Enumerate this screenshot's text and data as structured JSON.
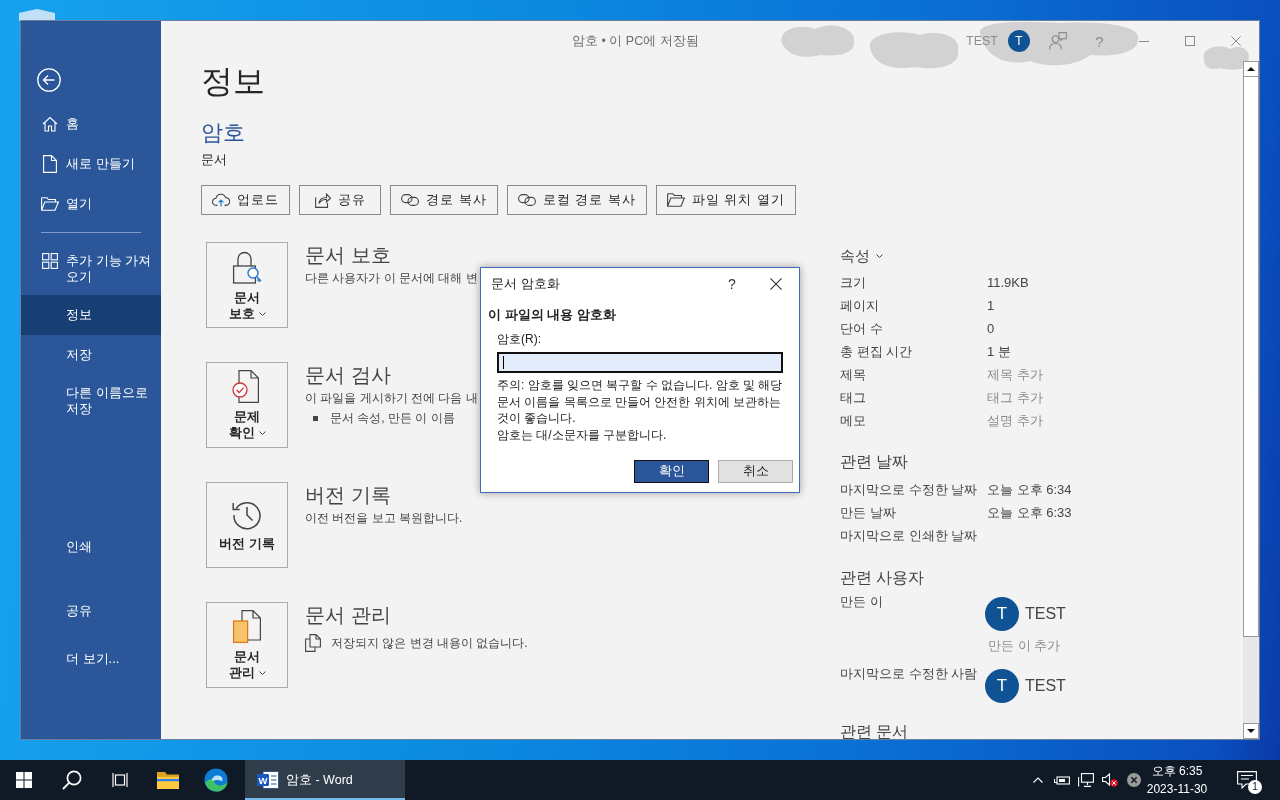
{
  "window": {
    "title": "암호 • 이 PC에 저장됨",
    "account": {
      "name": "TEST",
      "initial": "T"
    },
    "help": "?"
  },
  "sidebar": {
    "top_items": [
      {
        "lines": [
          "홈"
        ],
        "selected": false
      },
      {
        "lines": [
          "새로 만들기"
        ],
        "selected": false
      },
      {
        "lines": [
          "열기"
        ],
        "selected": false
      }
    ],
    "middle_items": [
      {
        "lines": [
          "추가 기능 가져",
          "오기"
        ],
        "selected": false
      },
      {
        "lines": [
          "정보"
        ],
        "selected": true
      },
      {
        "lines": [
          "저장"
        ],
        "selected": false
      },
      {
        "lines": [
          "다른 이름으로",
          "저장"
        ],
        "selected": false
      }
    ],
    "bottom_items": [
      {
        "lines": [
          "인쇄"
        ],
        "selected": false
      },
      {
        "lines": [
          "공유"
        ],
        "selected": false
      },
      {
        "lines": [
          "더 보기..."
        ],
        "selected": false
      }
    ]
  },
  "info": {
    "heading": "정보",
    "document_name": "암호",
    "document_location": "문서",
    "actions": [
      {
        "label": "업로드"
      },
      {
        "label": "공유"
      },
      {
        "label": "경로 복사"
      },
      {
        "label": "로컬 경로 복사"
      },
      {
        "label": "파일 위치 열기"
      }
    ]
  },
  "sections": [
    {
      "kind": "protect",
      "card_lines": [
        "문서",
        "보호"
      ],
      "dropdown": true,
      "title": "문서 보호",
      "description": "다른 사용자가 이 문서에 대해 변"
    },
    {
      "kind": "inspect",
      "card_lines": [
        "문제",
        "확인"
      ],
      "dropdown": true,
      "title": "문서 검사",
      "description": "이 파일을 게시하기 전에 다음 내",
      "bullets": [
        "문서 속성, 만든 이 이름"
      ]
    },
    {
      "kind": "versions",
      "card_lines": [
        "버전 기록"
      ],
      "dropdown": false,
      "title": "버전 기록",
      "description": "이전 버전을 보고 복원합니다."
    },
    {
      "kind": "manage",
      "card_lines": [
        "문서",
        "관리"
      ],
      "dropdown": true,
      "title": "문서 관리",
      "status": "저장되지 않은 변경 내용이 없습니다."
    }
  ],
  "properties": {
    "heading": "속성",
    "rows": [
      {
        "label": "크기",
        "value": "11.9KB"
      },
      {
        "label": "페이지",
        "value": "1"
      },
      {
        "label": "단어 수",
        "value": "0"
      },
      {
        "label": "총 편집 시간",
        "value": "1 분"
      },
      {
        "label": "제목",
        "placeholder": "제목 추가"
      },
      {
        "label": "태그",
        "placeholder": "태그 추가"
      },
      {
        "label": "메모",
        "placeholder": "설명 추가"
      }
    ]
  },
  "related_dates": {
    "heading": "관련 날짜",
    "rows": [
      {
        "label": "마지막으로 수정한 날짜",
        "value": "오늘 오후 6:34"
      },
      {
        "label": "만든 날짜",
        "value": "오늘 오후 6:33"
      },
      {
        "label": "마지막으로 인쇄한 날짜"
      }
    ]
  },
  "related_people": {
    "heading": "관련 사용자",
    "rows": [
      {
        "label": "만든 이",
        "people": [
          {
            "initial": "T",
            "name": "TEST"
          }
        ],
        "add_link": "만든 이 추가"
      },
      {
        "label": "마지막으로 수정한 사람",
        "people": [
          {
            "initial": "T",
            "name": "TEST"
          }
        ]
      }
    ]
  },
  "related_documents": {
    "heading": "관련 문서"
  },
  "dialog": {
    "title": "문서 암호화",
    "help": "?",
    "heading": "이 파일의 내용 암호화",
    "field": {
      "label": "암호(R):",
      "focused": true
    },
    "note": "주의: 암호를 잊으면 복구할 수 없습니다. 암호 및 해당 문서 이름을 목록으로 만들어 안전한 위치에 보관하는 것이 좋습니다.",
    "case_note": "암호는 대/소문자를 구분합니다.",
    "buttons": [
      {
        "label": "확인",
        "default": true
      },
      {
        "label": "취소",
        "default": false
      }
    ]
  },
  "taskbar": {
    "apps": [
      {
        "label": "암호 - Word",
        "icon_letter": "W",
        "active": true
      }
    ],
    "clock": {
      "time": "오후 6:35",
      "date": "2023-11-30"
    },
    "notification_count": "1"
  }
}
